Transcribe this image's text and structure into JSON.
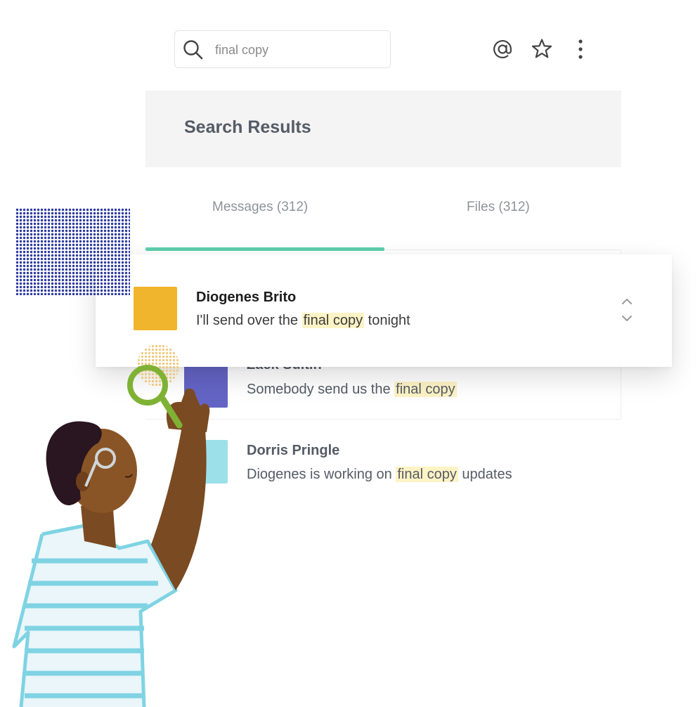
{
  "search": {
    "query": "final copy",
    "placeholder": "final copy"
  },
  "toolbar": {
    "icons": [
      "at-icon",
      "star-icon",
      "more-vertical-icon"
    ]
  },
  "results_header": {
    "title": "Search Results"
  },
  "tabs": [
    {
      "label": "Messages (312)",
      "active": true
    },
    {
      "label": "Files (312)",
      "active": false
    }
  ],
  "results": [
    {
      "sender": "Diogenes Brito",
      "avatar_color": "#f1b52d",
      "text_before": "I'll send over the ",
      "highlight": "final copy",
      "text_after": " tonight"
    },
    {
      "sender": "Zack Sultin",
      "avatar_color": "#6464c5",
      "text_before": "Somebody send us the ",
      "highlight": "final copy",
      "text_after": ""
    },
    {
      "sender": "Dorris Pringle",
      "avatar_color": "#9ce0ea",
      "text_before": "Diogenes is working on ",
      "highlight": "final copy",
      "text_after": " updates"
    }
  ],
  "colors": {
    "accent": "#5ecfae",
    "highlight": "#fdf3c5",
    "pattern": "#2e3a9e"
  }
}
